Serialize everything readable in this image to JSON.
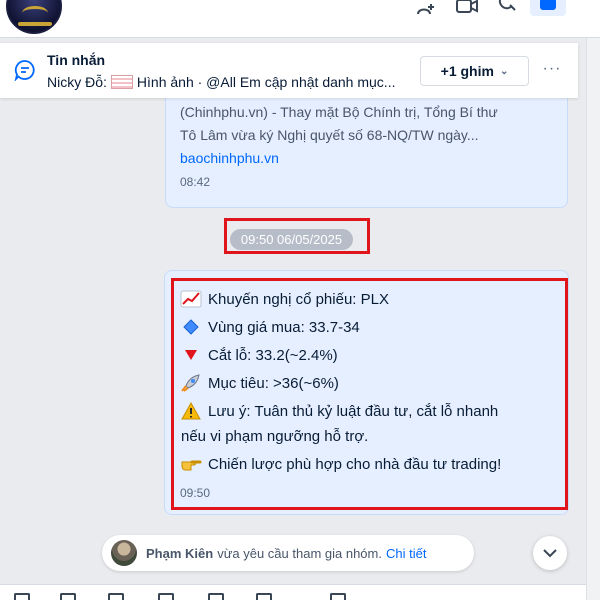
{
  "pinned": {
    "title": "Tin nhắn",
    "sender": "Nicky Đỗ:",
    "preview": "Hình ảnh · @All Em cập nhật danh mục...",
    "pin_button": "+1 ghim"
  },
  "messages": {
    "previous": {
      "line1": "(Chinhphu.vn) - Thay mặt Bộ Chính trị, Tổng Bí thư",
      "line2": "Tô Lâm vừa ký Nghị quyết số 68-NQ/TW ngày...",
      "link": "baochinhphu.vn",
      "time": "08:42"
    },
    "date_separator": "09:50 06/05/2025",
    "recommendation": {
      "lines": [
        {
          "icon": "chart-increasing-icon",
          "text": "Khuyến nghị cổ phiếu: PLX"
        },
        {
          "icon": "blue-diamond-icon",
          "text": "Vùng giá mua: 33.7-34"
        },
        {
          "icon": "red-triangle-down-icon",
          "text": "Cắt lỗ: 33.2(~2.4%)"
        },
        {
          "icon": "rocket-icon",
          "text": "Mục tiêu: >36(~6%)"
        },
        {
          "icon": "warning-icon",
          "text": "Lưu ý: Tuân thủ kỷ luật đầu tư, cắt lỗ nhanh"
        },
        {
          "icon": "",
          "text": "nếu vi phạm ngưỡng hỗ trợ."
        },
        {
          "icon": "pointing-right-icon",
          "text": "Chiến lược phù hợp cho nhà đầu tư trading!"
        }
      ],
      "time": "09:50"
    }
  },
  "notice": {
    "name": "Phạm Kiên",
    "text": "vừa yêu cầu tham gia nhóm.",
    "action": "Chi tiết"
  },
  "colors": {
    "accent": "#0068ff",
    "bubble": "#e5efff",
    "highlight": "#e0141b"
  }
}
